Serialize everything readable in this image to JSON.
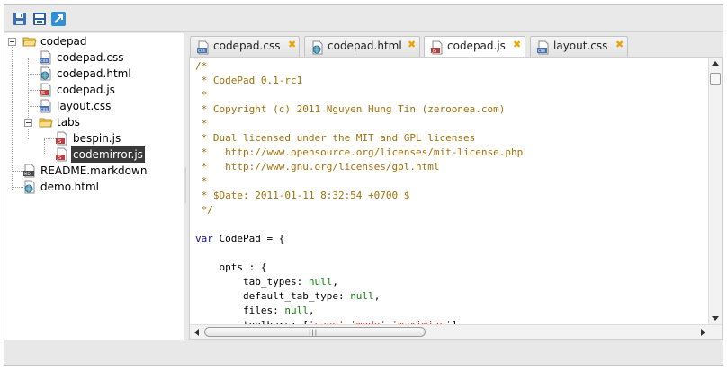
{
  "toolbar": {
    "buttons": [
      {
        "icon": "save-icon"
      },
      {
        "icon": "save-all-icon"
      },
      {
        "icon": "maximize-icon"
      }
    ]
  },
  "tree": {
    "root": {
      "label": "codepad",
      "icon": "folder-open-icon"
    },
    "items": [
      {
        "label": "codepad.css",
        "icon": "css-file-icon"
      },
      {
        "label": "codepad.html",
        "icon": "html-file-icon"
      },
      {
        "label": "codepad.js",
        "icon": "js-file-icon"
      },
      {
        "label": "layout.css",
        "icon": "css-file-icon"
      }
    ],
    "subfolder": {
      "label": "tabs",
      "icon": "folder-open-icon",
      "items": [
        {
          "label": "bespin.js",
          "icon": "js-file-icon"
        },
        {
          "label": "codemirror.js",
          "icon": "js-file-icon",
          "selected": true
        }
      ]
    },
    "trailing": [
      {
        "label": "README.markdown",
        "icon": "markdown-file-icon"
      },
      {
        "label": "demo.html",
        "icon": "html-file-icon"
      }
    ]
  },
  "tabs": [
    {
      "label": "codepad.css",
      "icon": "css-file-icon",
      "close": "✖"
    },
    {
      "label": "codepad.html",
      "icon": "html-file-icon",
      "close": "✖"
    },
    {
      "label": "codepad.js",
      "icon": "js-file-icon",
      "close": "✖",
      "active": true
    },
    {
      "label": "layout.css",
      "icon": "css-file-icon",
      "close": "✖"
    }
  ],
  "editor": {
    "lines": [
      [
        {
          "t": "/*",
          "c": "c-com"
        }
      ],
      [
        {
          "t": " * CodePad 0.1-rc1",
          "c": "c-com"
        }
      ],
      [
        {
          "t": " *",
          "c": "c-com"
        }
      ],
      [
        {
          "t": " * Copyright (c) 2011 Nguyen Hung Tin (zeroonea.com)",
          "c": "c-com"
        }
      ],
      [
        {
          "t": " *",
          "c": "c-com"
        }
      ],
      [
        {
          "t": " * Dual licensed under the MIT and GPL licenses",
          "c": "c-com"
        }
      ],
      [
        {
          "t": " *   http://www.opensource.org/licenses/mit-license.php",
          "c": "c-com"
        }
      ],
      [
        {
          "t": " *   http://www.gnu.org/licenses/gpl.html",
          "c": "c-com"
        }
      ],
      [
        {
          "t": " *",
          "c": "c-com"
        }
      ],
      [
        {
          "t": " * $Date: 2011-01-11 8:32:54 +0700 $",
          "c": "c-com"
        }
      ],
      [
        {
          "t": " */",
          "c": "c-com"
        }
      ],
      [
        {
          "t": "",
          "c": "c-plain"
        }
      ],
      [
        {
          "t": "var",
          "c": "c-kw"
        },
        {
          "t": " CodePad = {",
          "c": "c-plain"
        }
      ],
      [
        {
          "t": "",
          "c": "c-plain"
        }
      ],
      [
        {
          "t": "    opts : {",
          "c": "c-plain"
        }
      ],
      [
        {
          "t": "        tab_types: ",
          "c": "c-plain"
        },
        {
          "t": "null",
          "c": "c-null"
        },
        {
          "t": ",",
          "c": "c-plain"
        }
      ],
      [
        {
          "t": "        default_tab_type: ",
          "c": "c-plain"
        },
        {
          "t": "null",
          "c": "c-null"
        },
        {
          "t": ",",
          "c": "c-plain"
        }
      ],
      [
        {
          "t": "        files: ",
          "c": "c-plain"
        },
        {
          "t": "null",
          "c": "c-null"
        },
        {
          "t": ",",
          "c": "c-plain"
        }
      ],
      [
        {
          "t": "        toolbars: [",
          "c": "c-plain"
        },
        {
          "t": "'save','mode','maximize'",
          "c": "c-str"
        },
        {
          "t": "]",
          "c": "c-plain"
        }
      ]
    ]
  },
  "scrollbar": {
    "h_grip": "|||"
  }
}
